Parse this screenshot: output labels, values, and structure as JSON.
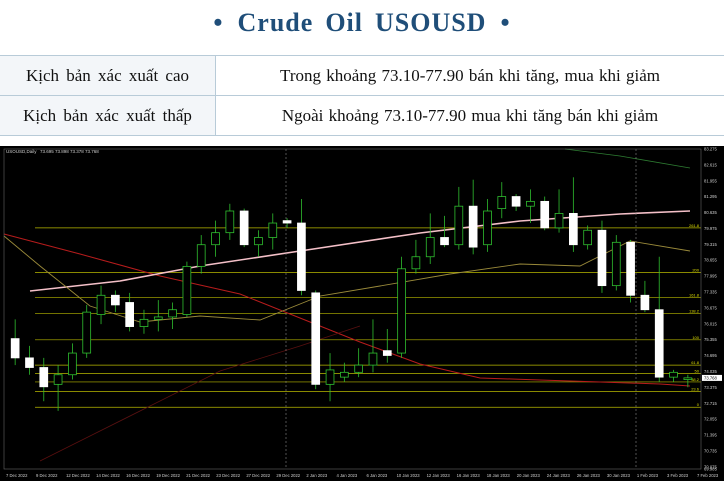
{
  "header": {
    "bullet_left": "•",
    "title_words": [
      "Crude",
      "Oil",
      "USOUSD"
    ],
    "bullet_right": "•"
  },
  "scenarios": [
    {
      "label": "Kịch bản xác xuất cao",
      "value": "Trong khoảng 73.10-77.90 bán khi tăng, mua khi giảm"
    },
    {
      "label": "Kịch bản xác xuất thấp",
      "value": "Ngoài khoảng 73.10-77.90 mua khi tăng bán khi giảm"
    }
  ],
  "chart_data": {
    "type": "candlestick",
    "symbol_label": "USOUSD,Daily",
    "ohlc_label": "73.695 73.898 73.378 73.768",
    "ylim": [
      69.985,
      83.275
    ],
    "y_ticks": [
      "83.275",
      "82.615",
      "81.955",
      "81.295",
      "80.635",
      "79.975",
      "79.315",
      "78.655",
      "77.995",
      "77.335",
      "76.675",
      "76.015",
      "75.355",
      "74.695",
      "74.035",
      "73.375",
      "72.715",
      "72.055",
      "71.395",
      "70.735",
      "70.075",
      "69.985"
    ],
    "x_ticks": [
      "7 Dec 2022",
      "9 Dec 2022",
      "12 Dec 2022",
      "14 Dec 2022",
      "16 Dec 2022",
      "19 Dec 2022",
      "21 Dec 2022",
      "23 Dec 2022",
      "27 Dec 2022",
      "29 Dec 2022",
      "2 Jan 2023",
      "4 Jan 2023",
      "6 Jan 2023",
      "10 Jan 2023",
      "12 Jan 2023",
      "16 Jan 2023",
      "18 Jan 2023",
      "20 Jan 2023",
      "24 Jan 2023",
      "26 Jan 2023",
      "30 Jan 2023",
      "1 Feb 2023",
      "3 Feb 2023",
      "7 Feb 2023"
    ],
    "fib_levels": [
      {
        "label": "261.8",
        "value": 80.0
      },
      {
        "label": "200",
        "value": 78.15
      },
      {
        "label": "161.8",
        "value": 77.1
      },
      {
        "label": "138.2",
        "value": 76.45
      },
      {
        "label": "100",
        "value": 75.35
      },
      {
        "label": "61.8",
        "value": 74.3
      },
      {
        "label": "50",
        "value": 73.95
      },
      {
        "label": "38.2",
        "value": 73.6
      },
      {
        "label": "23.6",
        "value": 73.2
      },
      {
        "label": "0",
        "value": 72.55
      }
    ],
    "last_price": "73.768",
    "candles": [
      {
        "o": 75.4,
        "h": 76.2,
        "l": 74.3,
        "c": 74.6
      },
      {
        "o": 74.6,
        "h": 75.1,
        "l": 73.9,
        "c": 74.2
      },
      {
        "o": 74.2,
        "h": 74.6,
        "l": 72.8,
        "c": 73.4
      },
      {
        "o": 73.5,
        "h": 74.3,
        "l": 72.4,
        "c": 73.9
      },
      {
        "o": 73.9,
        "h": 75.2,
        "l": 73.7,
        "c": 74.8
      },
      {
        "o": 74.8,
        "h": 76.8,
        "l": 74.6,
        "c": 76.5
      },
      {
        "o": 76.4,
        "h": 77.6,
        "l": 76.0,
        "c": 77.2
      },
      {
        "o": 77.2,
        "h": 77.4,
        "l": 76.5,
        "c": 76.8
      },
      {
        "o": 76.9,
        "h": 77.3,
        "l": 75.7,
        "c": 75.9
      },
      {
        "o": 75.9,
        "h": 76.6,
        "l": 75.6,
        "c": 76.2
      },
      {
        "o": 76.2,
        "h": 77.0,
        "l": 75.7,
        "c": 76.3
      },
      {
        "o": 76.3,
        "h": 76.9,
        "l": 75.8,
        "c": 76.6
      },
      {
        "o": 76.4,
        "h": 78.6,
        "l": 76.3,
        "c": 78.4
      },
      {
        "o": 78.4,
        "h": 79.7,
        "l": 78.1,
        "c": 79.3
      },
      {
        "o": 79.3,
        "h": 80.3,
        "l": 78.8,
        "c": 79.8
      },
      {
        "o": 79.8,
        "h": 81.0,
        "l": 79.5,
        "c": 80.7
      },
      {
        "o": 80.7,
        "h": 80.8,
        "l": 79.2,
        "c": 79.3
      },
      {
        "o": 79.3,
        "h": 79.9,
        "l": 78.8,
        "c": 79.6
      },
      {
        "o": 79.6,
        "h": 80.6,
        "l": 79.1,
        "c": 80.2
      },
      {
        "o": 80.3,
        "h": 80.4,
        "l": 80.0,
        "c": 80.2
      },
      {
        "o": 80.2,
        "h": 81.2,
        "l": 77.2,
        "c": 77.4
      },
      {
        "o": 77.3,
        "h": 77.4,
        "l": 73.3,
        "c": 73.5
      },
      {
        "o": 73.5,
        "h": 74.8,
        "l": 72.8,
        "c": 74.1
      },
      {
        "o": 73.8,
        "h": 74.4,
        "l": 73.6,
        "c": 74.0
      },
      {
        "o": 74.0,
        "h": 75.0,
        "l": 73.8,
        "c": 74.3
      },
      {
        "o": 74.3,
        "h": 76.2,
        "l": 74.0,
        "c": 74.8
      },
      {
        "o": 74.9,
        "h": 75.8,
        "l": 74.4,
        "c": 74.7
      },
      {
        "o": 74.8,
        "h": 78.8,
        "l": 74.6,
        "c": 78.3
      },
      {
        "o": 78.3,
        "h": 79.5,
        "l": 78.1,
        "c": 78.8
      },
      {
        "o": 78.8,
        "h": 80.6,
        "l": 78.5,
        "c": 79.6
      },
      {
        "o": 79.6,
        "h": 80.5,
        "l": 79.2,
        "c": 79.3
      },
      {
        "o": 79.3,
        "h": 81.7,
        "l": 79.1,
        "c": 80.9
      },
      {
        "o": 80.9,
        "h": 82.0,
        "l": 78.9,
        "c": 79.2
      },
      {
        "o": 79.3,
        "h": 81.2,
        "l": 79.0,
        "c": 80.7
      },
      {
        "o": 80.8,
        "h": 81.9,
        "l": 80.4,
        "c": 81.3
      },
      {
        "o": 81.3,
        "h": 81.4,
        "l": 80.7,
        "c": 80.9
      },
      {
        "o": 80.9,
        "h": 81.6,
        "l": 80.2,
        "c": 81.1
      },
      {
        "o": 81.1,
        "h": 81.3,
        "l": 79.9,
        "c": 80.0
      },
      {
        "o": 80.0,
        "h": 81.6,
        "l": 79.8,
        "c": 80.6
      },
      {
        "o": 80.6,
        "h": 82.1,
        "l": 79.0,
        "c": 79.3
      },
      {
        "o": 79.3,
        "h": 80.1,
        "l": 79.1,
        "c": 79.9
      },
      {
        "o": 79.9,
        "h": 80.3,
        "l": 77.3,
        "c": 77.6
      },
      {
        "o": 77.6,
        "h": 79.7,
        "l": 77.4,
        "c": 79.4
      },
      {
        "o": 79.4,
        "h": 79.5,
        "l": 76.9,
        "c": 77.2
      },
      {
        "o": 77.2,
        "h": 77.8,
        "l": 76.5,
        "c": 76.6
      },
      {
        "o": 76.6,
        "h": 78.8,
        "l": 73.6,
        "c": 73.8
      },
      {
        "o": 73.8,
        "h": 74.1,
        "l": 73.6,
        "c": 74.0
      },
      {
        "o": 73.7,
        "h": 73.9,
        "l": 73.38,
        "c": 73.77
      }
    ]
  }
}
